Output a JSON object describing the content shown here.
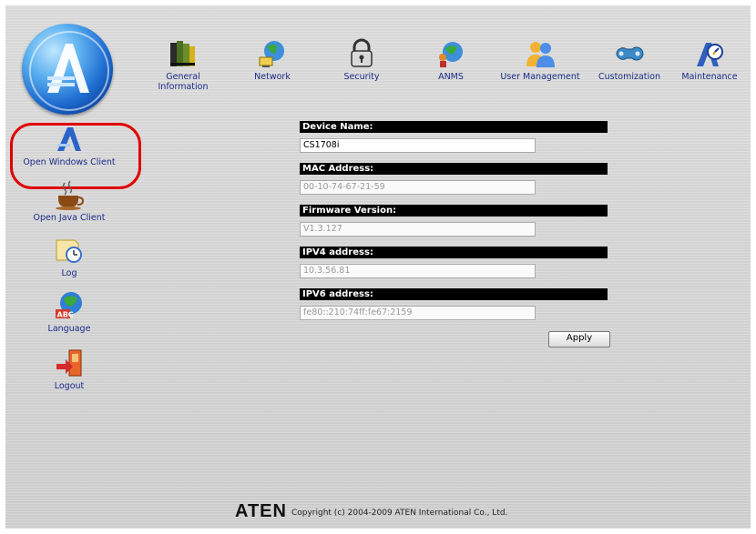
{
  "top_nav": [
    {
      "label": "General Information",
      "icon": "books-icon"
    },
    {
      "label": "Network",
      "icon": "globe-network-icon"
    },
    {
      "label": "Security",
      "icon": "padlock-icon"
    },
    {
      "label": "ANMS",
      "icon": "anms-icon"
    },
    {
      "label": "User Management",
      "icon": "users-icon"
    },
    {
      "label": "Customization",
      "icon": "wrench-icon"
    },
    {
      "label": "Maintenance",
      "icon": "maintenance-icon"
    }
  ],
  "sidebar": [
    {
      "label": "Open Windows Client",
      "icon": "windows-client-icon",
      "highlighted": true
    },
    {
      "label": "Open Java Client",
      "icon": "java-cup-icon"
    },
    {
      "label": "Log",
      "icon": "log-clock-icon"
    },
    {
      "label": "Language",
      "icon": "language-globe-icon"
    },
    {
      "label": "Logout",
      "icon": "logout-door-icon"
    }
  ],
  "form": {
    "device_name": {
      "label": "Device Name:",
      "value": "CS1708i",
      "editable": true
    },
    "mac_address": {
      "label": "MAC Address:",
      "value": "00-10-74-67-21-59",
      "editable": false
    },
    "firmware_version": {
      "label": "Firmware Version:",
      "value": "V1.3.127",
      "editable": false
    },
    "ipv4": {
      "label": "IPV4 address:",
      "value": "10.3.56.81",
      "editable": false
    },
    "ipv6": {
      "label": "IPV6 address:",
      "value": "fe80::210:74ff:fe67:2159",
      "editable": false
    },
    "apply_label": "Apply"
  },
  "footer": {
    "brand": "ATEN",
    "copyright": "Copyright (c) 2004-2009 ATEN International Co., Ltd."
  },
  "colors": {
    "nav_text": "#1a2b8a",
    "highlight_ring": "#e00000",
    "header_bar": "#000000"
  }
}
